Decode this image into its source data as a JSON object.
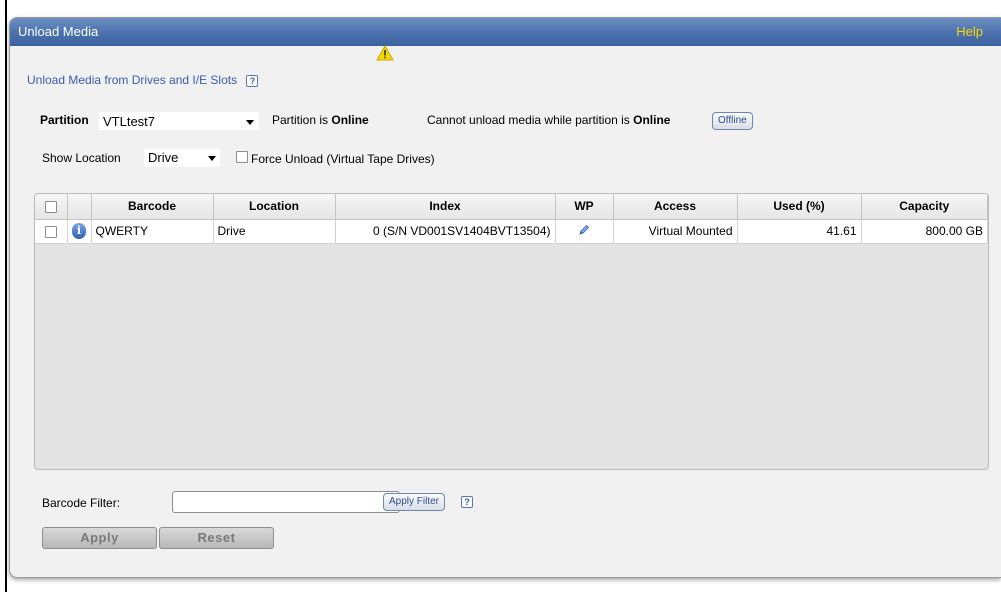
{
  "header": {
    "title": "Unload Media",
    "help": "Help"
  },
  "subtitle": "Unload Media from Drives and I/E Slots",
  "help_mark": "?",
  "partition": {
    "label": "Partition",
    "value": "VTLtest7",
    "status_prefix": "Partition is",
    "status_value": "Online",
    "warning_prefix": "Cannot unload media while partition is",
    "warning_value": "Online",
    "offline_button": "Offline"
  },
  "location": {
    "label": "Show Location",
    "value": "Drive",
    "force_label": "Force Unload (Virtual Tape Drives)"
  },
  "grid": {
    "columns": [
      "Barcode",
      "Location",
      "Index",
      "WP",
      "Access",
      "Used (%)",
      "Capacity"
    ],
    "rows": [
      {
        "barcode": "QWERTY",
        "location": "Drive",
        "index": "0 (S/N VD001SV1404BVT13504)",
        "access": "Virtual Mounted",
        "used": "41.61",
        "capacity": "800.00 GB"
      }
    ]
  },
  "filter": {
    "label": "Barcode Filter:",
    "value": "",
    "apply_filter": "Apply Filter"
  },
  "actions": {
    "apply": "Apply",
    "reset": "Reset"
  },
  "colors": {
    "title_bar": "#4a70ad",
    "help_link": "#ffd800",
    "subtitle": "#3b5ca8",
    "warning": "#f2d200"
  },
  "icons": {
    "warning": "warning-icon",
    "info": "info-icon",
    "edit": "pencil-icon",
    "help": "help-icon"
  }
}
